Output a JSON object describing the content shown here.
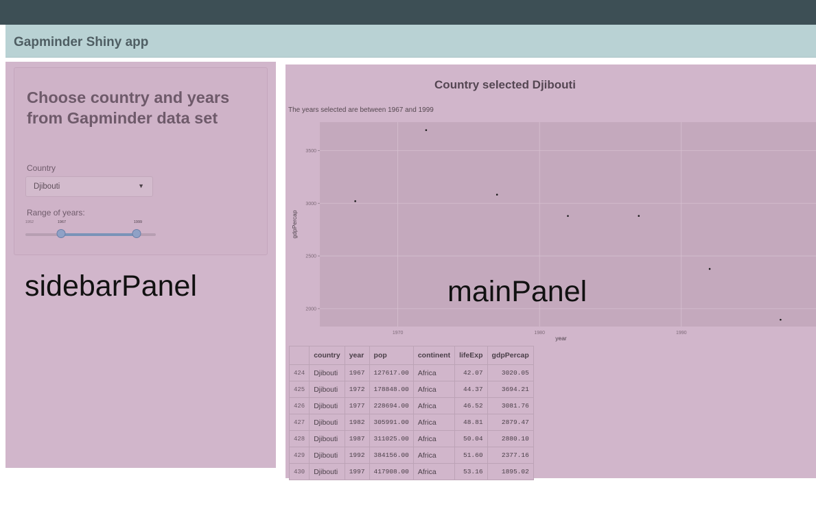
{
  "app": {
    "title": "Gapminder Shiny app"
  },
  "sidebar": {
    "heading": "Choose country and years from Gapminder data set",
    "country_label": "Country",
    "country_value": "Djibouti",
    "range_label": "Range of years:",
    "slider": {
      "min": 1952,
      "max": 2007,
      "from": 1967,
      "to": 1999,
      "tick_labels": [
        "1952",
        "1967",
        "1999"
      ]
    },
    "panel_label": "sidebarPanel"
  },
  "main": {
    "title": "Country selected Djibouti",
    "years_text": "The years selected are between 1967 and 1999",
    "panel_label": "mainPanel"
  },
  "chart_data": {
    "type": "scatter",
    "xlabel": "year",
    "ylabel": "gdpPercap",
    "x": [
      1967,
      1972,
      1977,
      1982,
      1987,
      1992,
      1997
    ],
    "y": [
      3020.05,
      3694.21,
      3081.76,
      2879.47,
      2880.1,
      2377.16,
      1895.02
    ],
    "xlim": [
      1964.5,
      1999.5
    ],
    "ylim": [
      1830,
      3770
    ],
    "xticks": [
      1970,
      1980,
      1990
    ],
    "yticks": [
      2000,
      2500,
      3000,
      3500
    ],
    "grid": true,
    "colors": {
      "panel": "#c4a9bd",
      "grid": "#d6c0d0",
      "point": "#1a1a1a"
    }
  },
  "table": {
    "columns": [
      "",
      "country",
      "year",
      "pop",
      "continent",
      "lifeExp",
      "gdpPercap"
    ],
    "rows": [
      [
        "424",
        "Djibouti",
        "1967",
        "127617.00",
        "Africa",
        "42.07",
        "3020.05"
      ],
      [
        "425",
        "Djibouti",
        "1972",
        "178848.00",
        "Africa",
        "44.37",
        "3694.21"
      ],
      [
        "426",
        "Djibouti",
        "1977",
        "228694.00",
        "Africa",
        "46.52",
        "3081.76"
      ],
      [
        "427",
        "Djibouti",
        "1982",
        "305991.00",
        "Africa",
        "48.81",
        "2879.47"
      ],
      [
        "428",
        "Djibouti",
        "1987",
        "311025.00",
        "Africa",
        "50.04",
        "2880.10"
      ],
      [
        "429",
        "Djibouti",
        "1992",
        "384156.00",
        "Africa",
        "51.60",
        "2377.16"
      ],
      [
        "430",
        "Djibouti",
        "1997",
        "417908.00",
        "Africa",
        "53.16",
        "1895.02"
      ]
    ]
  }
}
